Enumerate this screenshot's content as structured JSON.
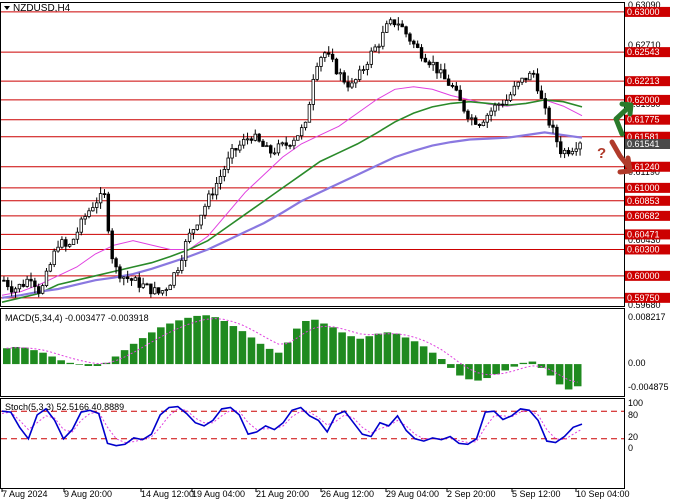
{
  "window": {
    "title": "NZDUSD,H4"
  },
  "colors": {
    "bull_candle": "#000000",
    "bear_candle": "#000000",
    "ma_pink": "#e040e0",
    "ma_green": "#2a8a2a",
    "ma_purple": "#8a78e0",
    "level_line": "#cc0000",
    "macd_bar": "#1f8a1f",
    "macd_signal": "#e040e0",
    "stoch_main": "#0000cc",
    "stoch_signal": "#e040e0",
    "up_arrow": "#2a7a2a",
    "down_arrow": "#b03a2a",
    "question": "#b03a2a"
  },
  "price_axis": {
    "top_label": "0.63090",
    "bottom_label": "0.59680",
    "ticks": [
      "0.62710",
      "0.61950",
      "0.61190",
      "0.60430"
    ]
  },
  "levels": [
    {
      "label": "0.63000",
      "value": 0.63
    },
    {
      "label": "0.62543",
      "value": 0.62543
    },
    {
      "label": "0.62213",
      "value": 0.62213
    },
    {
      "label": "0.62000",
      "value": 0.62
    },
    {
      "label": "0.61775",
      "value": 0.61775
    },
    {
      "label": "0.61581",
      "value": 0.61581
    },
    {
      "label": "0.61240",
      "value": 0.6124
    },
    {
      "label": "0.61000",
      "value": 0.61
    },
    {
      "label": "0.60853",
      "value": 0.60853
    },
    {
      "label": "0.60682",
      "value": 0.60682
    },
    {
      "label": "0.60471",
      "value": 0.60471
    },
    {
      "label": "0.60300",
      "value": 0.603
    },
    {
      "label": "0.60000",
      "value": 0.6
    },
    {
      "label": "0.59750",
      "value": 0.5975
    }
  ],
  "current_price_label": "0.61541",
  "macd": {
    "label": "MACD(5,34,4) -0.003477 -0.003918",
    "axis": {
      "top_label": "0.008217",
      "zero_label": "0.00",
      "bottom_label": "-0.004875"
    }
  },
  "stoch": {
    "label": "Stoch(5,3,3) 52.5166 40.8889",
    "axis": {
      "top_label": "100",
      "upper_label": "80",
      "lower_label": "20",
      "bottom_label": "0"
    }
  },
  "time_axis": [
    "7 Aug 2024",
    "9 Aug 20:00",
    "14 Aug 12:00",
    "19 Aug 04:00",
    "21 Aug 20:00",
    "26 Aug 12:00",
    "29 Aug 04:00",
    "2 Sep 20:00",
    "5 Sep 12:00",
    "10 Sep 04:00"
  ],
  "annotation": {
    "question": "?"
  },
  "chart_data": {
    "type": "candlestick",
    "symbol": "NZDUSD",
    "timeframe": "H4",
    "ylim": [
      0.5968,
      0.6309
    ],
    "close_path": [
      0.5995,
      0.5985,
      0.599,
      0.6,
      0.598,
      0.601,
      0.604,
      0.603,
      0.605,
      0.607,
      0.6085,
      0.609,
      0.601,
      0.6,
      0.5995,
      0.599,
      0.5985,
      0.598,
      0.599,
      0.601,
      0.604,
      0.606,
      0.608,
      0.61,
      0.612,
      0.614,
      0.615,
      0.616,
      0.615,
      0.614,
      0.6145,
      0.615,
      0.616,
      0.617,
      0.624,
      0.6255,
      0.624,
      0.6225,
      0.6215,
      0.623,
      0.625,
      0.6265,
      0.6285,
      0.629,
      0.6275,
      0.626,
      0.625,
      0.624,
      0.6225,
      0.6215,
      0.6195,
      0.618,
      0.6175,
      0.6185,
      0.6195,
      0.62,
      0.6215,
      0.6225,
      0.623,
      0.619,
      0.6165,
      0.614,
      0.6145,
      0.6154
    ],
    "ma_pink_path": [
      0.5978,
      0.5982,
      0.599,
      0.6,
      0.601,
      0.6025,
      0.6035,
      0.604,
      0.6035,
      0.603,
      0.603,
      0.6045,
      0.607,
      0.6095,
      0.6115,
      0.6135,
      0.615,
      0.616,
      0.617,
      0.6185,
      0.62,
      0.6212,
      0.6215,
      0.6212,
      0.6205,
      0.62,
      0.6195,
      0.6193,
      0.6196,
      0.62,
      0.6193,
      0.6182
    ],
    "ma_green_path": [
      0.597,
      0.5975,
      0.598,
      0.599,
      0.5995,
      0.6,
      0.6005,
      0.601,
      0.6015,
      0.6022,
      0.603,
      0.604,
      0.6055,
      0.607,
      0.6085,
      0.61,
      0.6115,
      0.613,
      0.614,
      0.615,
      0.6162,
      0.6175,
      0.6185,
      0.6192,
      0.6196,
      0.6198,
      0.6196,
      0.6194,
      0.6196,
      0.62,
      0.6198,
      0.6192
    ],
    "ma_purple_path": [
      0.5975,
      0.5978,
      0.5982,
      0.5985,
      0.599,
      0.5995,
      0.5998,
      0.6002,
      0.6008,
      0.6015,
      0.6022,
      0.603,
      0.604,
      0.605,
      0.606,
      0.6072,
      0.6085,
      0.6095,
      0.6105,
      0.6115,
      0.6125,
      0.6135,
      0.6142,
      0.6148,
      0.6152,
      0.6155,
      0.6156,
      0.6157,
      0.616,
      0.6163,
      0.616,
      0.6157
    ],
    "macd_hist": [
      0.0025,
      0.0027,
      0.0026,
      0.0022,
      0.0018,
      0.0012,
      0.0006,
      0.0002,
      -0.0001,
      -0.0003,
      -0.0003,
      0.0002,
      0.0012,
      0.0022,
      0.0032,
      0.0041,
      0.005,
      0.0058,
      0.0064,
      0.0069,
      0.0073,
      0.0076,
      0.0077,
      0.0074,
      0.0068,
      0.006,
      0.0052,
      0.0042,
      0.0032,
      0.0024,
      0.0018,
      0.0034,
      0.0056,
      0.0068,
      0.007,
      0.0064,
      0.0058,
      0.005,
      0.0044,
      0.004,
      0.0044,
      0.0048,
      0.005,
      0.0048,
      0.0042,
      0.0036,
      0.0028,
      0.0018,
      0.0008,
      -0.0006,
      -0.0018,
      -0.0024,
      -0.0026,
      -0.0022,
      -0.0016,
      -0.001,
      -0.0004,
      0.0002,
      0.0004,
      -0.0006,
      -0.0018,
      -0.0032,
      -0.004,
      -0.0035
    ],
    "stoch_main": [
      80,
      78,
      45,
      20,
      72,
      85,
      60,
      20,
      40,
      78,
      82,
      75,
      10,
      5,
      8,
      22,
      18,
      30,
      72,
      88,
      90,
      75,
      55,
      48,
      60,
      85,
      88,
      72,
      30,
      35,
      48,
      40,
      55,
      82,
      88,
      70,
      60,
      35,
      72,
      80,
      55,
      30,
      25,
      55,
      48,
      70,
      38,
      20,
      15,
      22,
      18,
      25,
      10,
      8,
      20,
      78,
      80,
      62,
      70,
      85,
      82,
      60,
      15,
      12,
      25,
      45,
      52
    ],
    "stoch_signal": [
      75,
      78,
      60,
      40,
      55,
      70,
      65,
      40,
      35,
      60,
      75,
      78,
      45,
      20,
      12,
      14,
      18,
      24,
      45,
      70,
      85,
      82,
      65,
      55,
      55,
      70,
      82,
      80,
      55,
      40,
      42,
      42,
      48,
      68,
      80,
      78,
      66,
      50,
      58,
      72,
      65,
      45,
      32,
      42,
      48,
      60,
      48,
      30,
      20,
      20,
      20,
      22,
      16,
      12,
      14,
      45,
      70,
      70,
      68,
      78,
      82,
      72,
      40,
      20,
      18,
      30,
      41
    ]
  }
}
